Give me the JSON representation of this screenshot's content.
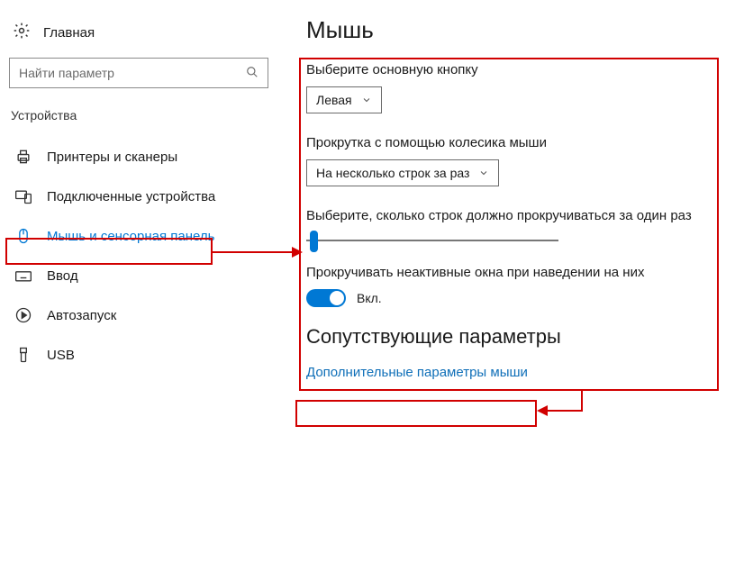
{
  "sidebar": {
    "home_label": "Главная",
    "search_placeholder": "Найти параметр",
    "group_label": "Устройства",
    "items": [
      {
        "label": "Принтеры и сканеры"
      },
      {
        "label": "Подключенные устройства"
      },
      {
        "label": "Мышь и сенсорная панель"
      },
      {
        "label": "Ввод"
      },
      {
        "label": "Автозапуск"
      },
      {
        "label": "USB"
      }
    ]
  },
  "main": {
    "title": "Мышь",
    "primary_button_label": "Выберите основную кнопку",
    "primary_button_value": "Левая",
    "scroll_mode_label": "Прокрутка с помощью колесика мыши",
    "scroll_mode_value": "На несколько строк за раз",
    "lines_label": "Выберите, сколько строк должно прокручиваться за один раз",
    "inactive_scroll_label": "Прокручивать неактивные окна при наведении на них",
    "toggle_on_label": "Вкл.",
    "related_section": "Сопутствующие параметры",
    "related_link": "Дополнительные параметры мыши"
  }
}
